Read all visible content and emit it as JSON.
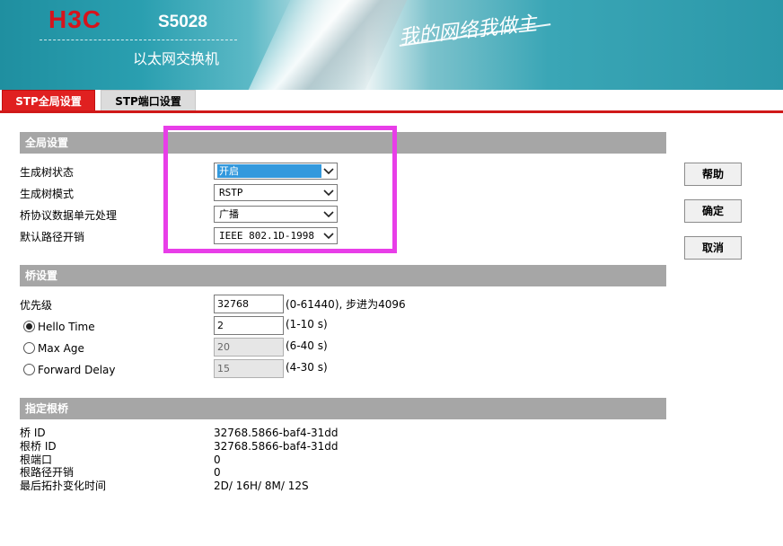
{
  "banner": {
    "logo": "H3C",
    "model": "S5028",
    "subtitle": "以太网交换机",
    "slogan": "我的网络我做主"
  },
  "tabs": [
    {
      "label": "STP全局设置",
      "active": true
    },
    {
      "label": "STP端口设置",
      "active": false
    }
  ],
  "global_settings": {
    "title": "全局设置",
    "rows": [
      {
        "label": "生成树状态",
        "value": "开启"
      },
      {
        "label": "生成树模式",
        "value": "RSTP"
      },
      {
        "label": "桥协议数据单元处理",
        "value": "广播"
      },
      {
        "label": "默认路径开销",
        "value": "IEEE 802.1D-1998"
      }
    ]
  },
  "bridge_settings": {
    "title": "桥设置",
    "priority": {
      "label": "优先级",
      "value": "32768",
      "hint": "(0-61440), 步进为4096"
    },
    "hello_time": {
      "label": "Hello Time",
      "value": "2",
      "hint": "(1-10 s)",
      "checked": true
    },
    "max_age": {
      "label": "Max Age",
      "value": "20",
      "hint": "(6-40 s)",
      "checked": false
    },
    "forward_delay": {
      "label": "Forward Delay",
      "value": "15",
      "hint": "(4-30 s)",
      "checked": false
    }
  },
  "root_bridge": {
    "title": "指定根桥",
    "rows": [
      {
        "label": "桥 ID",
        "value": "32768.5866-baf4-31dd"
      },
      {
        "label": "根桥 ID",
        "value": "32768.5866-baf4-31dd"
      },
      {
        "label": "根端口",
        "value": "0"
      },
      {
        "label": "根路径开销",
        "value": "0"
      },
      {
        "label": "最后拓扑变化时间",
        "value": "2D/ 16H/ 8M/ 12S"
      }
    ]
  },
  "buttons": {
    "help": "帮助",
    "confirm": "确定",
    "cancel": "取消"
  },
  "colors": {
    "tab_active": "#e02020",
    "section_header": "#a6a6a6",
    "highlight": "#e83ee8",
    "select_focus": "#3399dd"
  }
}
